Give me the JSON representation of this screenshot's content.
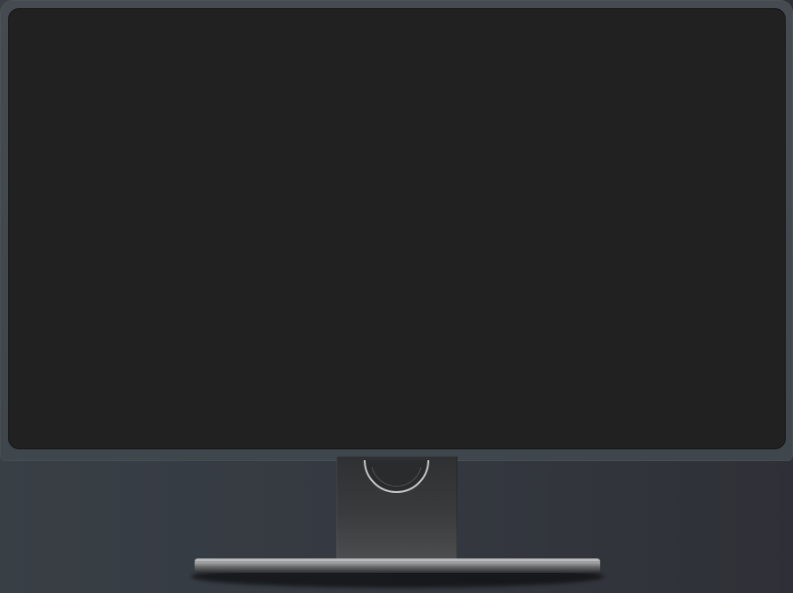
{
  "scene": {
    "object": "monitor",
    "colors": {
      "background_left": "#383f45",
      "background_right": "#2f3037",
      "bezel": "#43494f",
      "screen": "#212121",
      "stand": "#3a3b3d",
      "base": "#9fa0a2"
    },
    "screen_state": "off"
  }
}
